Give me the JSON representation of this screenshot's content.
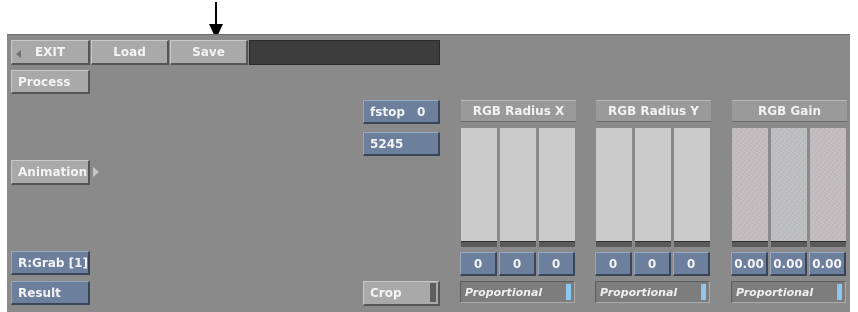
{
  "toolbar": {
    "exit": "EXIT",
    "load": "Load",
    "save": "Save",
    "process": "Process"
  },
  "left": {
    "animation": "Animation",
    "grab": "R:Grab [1]",
    "result": "Result"
  },
  "middle": {
    "fstop_label": "fstop",
    "fstop_value": "0",
    "number": "5245",
    "crop": "Crop"
  },
  "groups": [
    {
      "title": "RGB Radius X",
      "values": [
        "0",
        "0",
        "0"
      ],
      "mode": "Proportional"
    },
    {
      "title": "RGB Radius Y",
      "values": [
        "0",
        "0",
        "0"
      ],
      "mode": "Proportional"
    },
    {
      "title": "RGB Gain",
      "values": [
        "0.00",
        "0.00",
        "0.00"
      ],
      "mode": "Proportional"
    }
  ],
  "colors": {
    "panel": "#8a8a8a",
    "blue_button": "#6c7f9c",
    "indicator": "#8ec8f0"
  }
}
